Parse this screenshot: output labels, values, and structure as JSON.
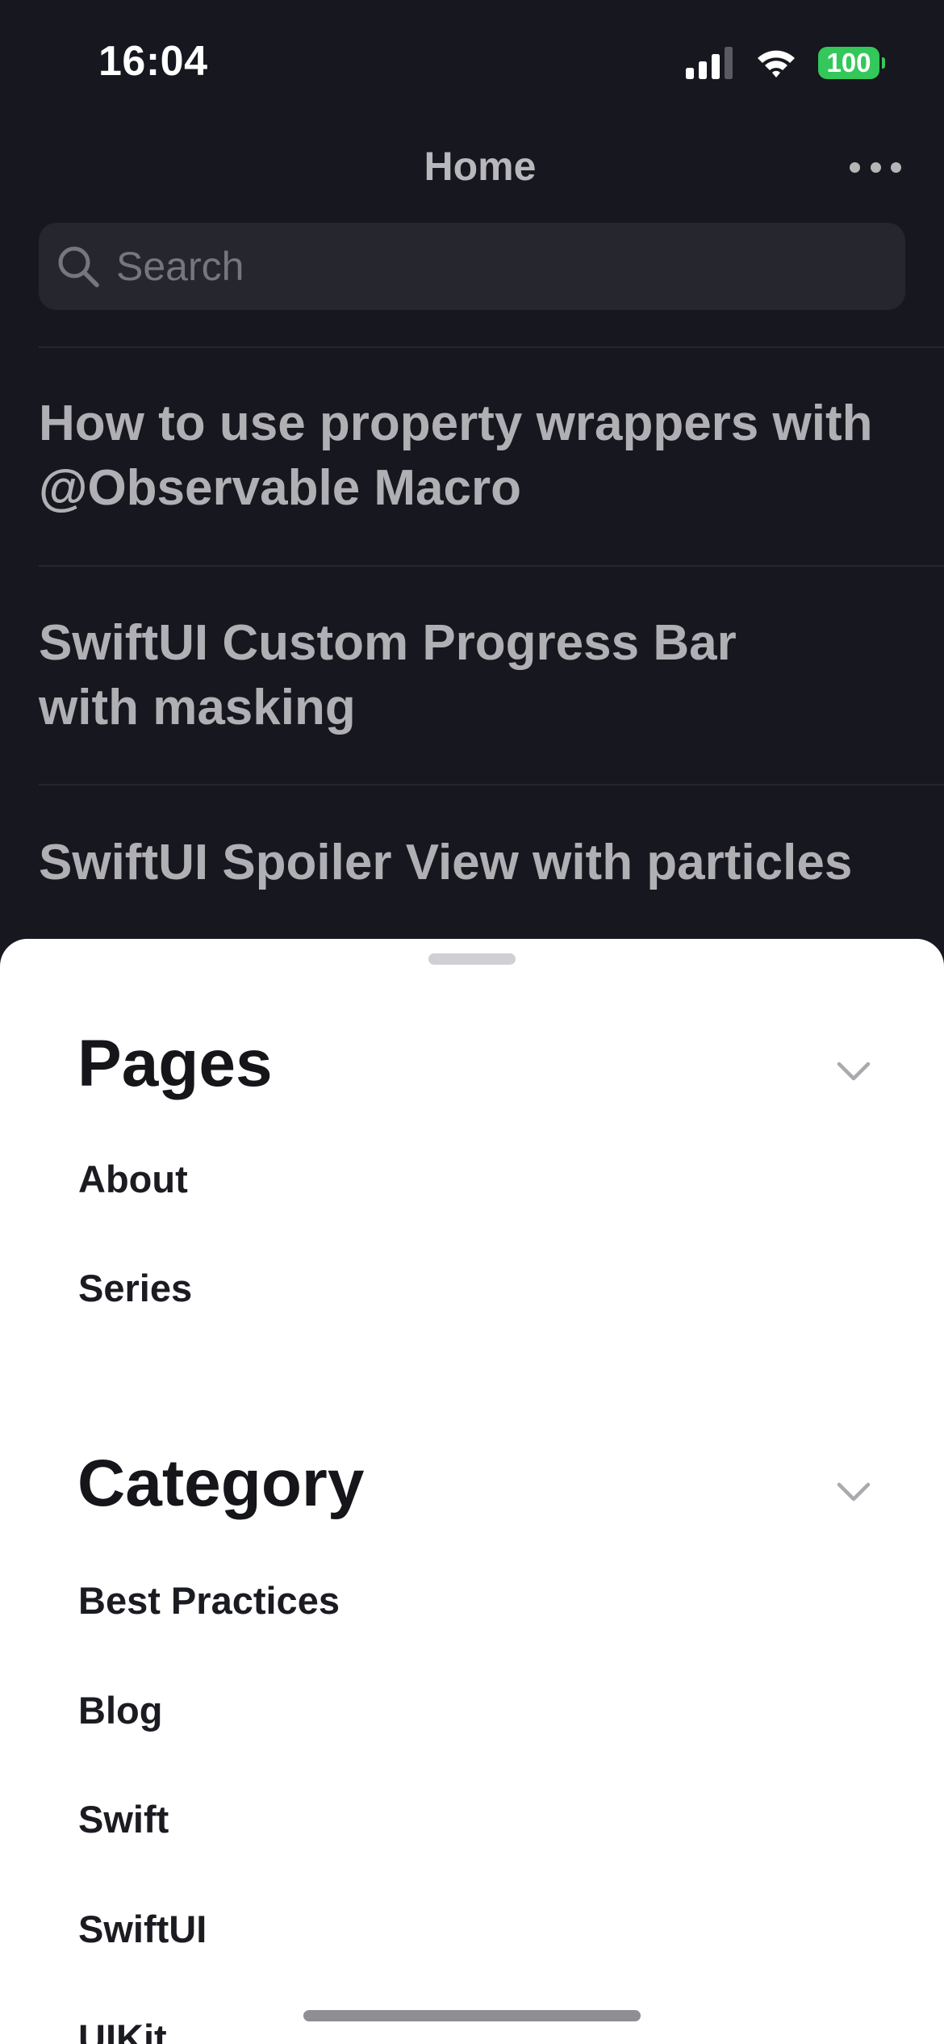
{
  "status_bar": {
    "time": "16:04",
    "battery": "100",
    "battery_color": "#34c759",
    "icons": [
      "signal-icon",
      "wifi-icon",
      "battery-icon"
    ]
  },
  "nav": {
    "title": "Home",
    "more_icon": "ellipsis-icon"
  },
  "search": {
    "placeholder": "Search",
    "icon": "search-icon"
  },
  "posts": [
    {
      "title": "How to use property wrappers with\n@Observable Macro"
    },
    {
      "title": "SwiftUI Custom Progress Bar\nwith masking"
    },
    {
      "title": "SwiftUI Spoiler View with particles"
    }
  ],
  "sheet": {
    "pages": {
      "title": "Pages",
      "items": [
        "About",
        "Series"
      ]
    },
    "category": {
      "title": "Category",
      "items": [
        "Best Practices",
        "Blog",
        "Swift",
        "SwiftUI",
        "UIKit"
      ]
    }
  },
  "colors": {
    "background": "#17171f",
    "sheet": "#ffffff",
    "accent": "#34c759"
  }
}
